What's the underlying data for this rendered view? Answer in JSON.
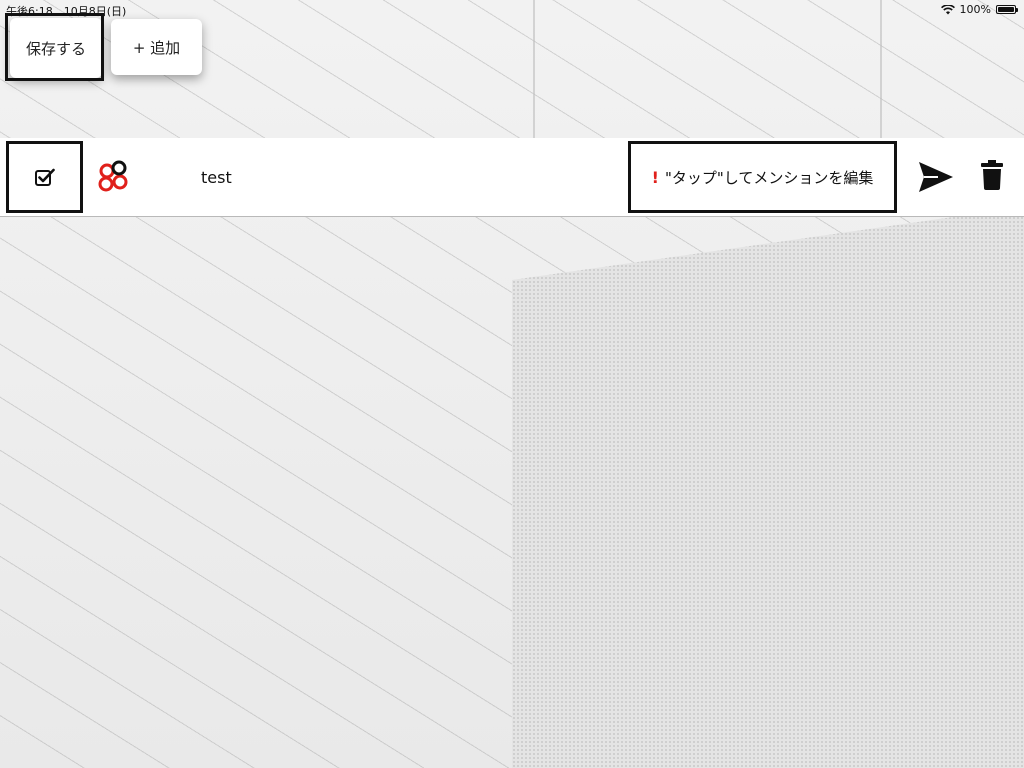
{
  "status_bar": {
    "time_date": "午後6:18　10月8日(日)",
    "battery_percent": "100%",
    "battery_level": 1.0
  },
  "toolbar": {
    "save_label": "保存する",
    "add_label": "+ 追加"
  },
  "row": {
    "checked": true,
    "name": "test",
    "mention_warning_icon": "!",
    "mention_label": "\"タップ\"してメンションを編集"
  },
  "icons": {
    "checkbox": "checkbox-checked-icon",
    "app": "flower-logo-icon",
    "send": "send-icon",
    "delete": "trash-icon",
    "wifi": "wifi-icon",
    "battery": "battery-icon"
  },
  "colors": {
    "warning": "#e0201b",
    "app_icon_red": "#e0201b",
    "text": "#111111"
  }
}
